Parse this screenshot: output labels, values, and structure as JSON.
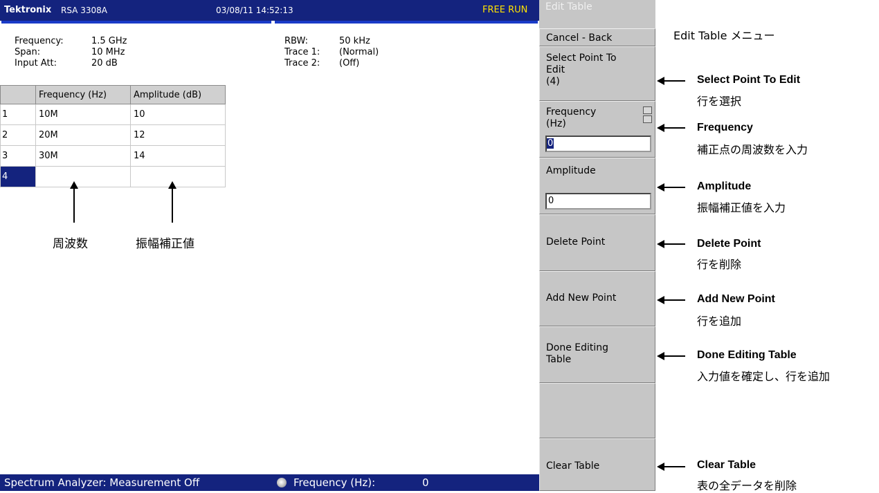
{
  "header": {
    "brand": "Tektronix",
    "model": "RSA 3308A",
    "datetime": "03/08/11 14:52:13",
    "run_state": "FREE RUN"
  },
  "settings_left": [
    {
      "label": "Frequency:",
      "value": "1.5 GHz"
    },
    {
      "label": "Span:",
      "value": "10 MHz"
    },
    {
      "label": "Input Att:",
      "value": "20 dB"
    }
  ],
  "settings_right": [
    {
      "label": "RBW:",
      "value": "50 kHz"
    },
    {
      "label": "Trace 1:",
      "value": "(Normal)"
    },
    {
      "label": "Trace 2:",
      "value": "(Off)"
    }
  ],
  "table": {
    "headers": [
      "",
      "Frequency (Hz)",
      "Amplitude (dB)"
    ],
    "rows": [
      {
        "index": "1",
        "frequency": "10M",
        "amplitude": "10"
      },
      {
        "index": "2",
        "frequency": "20M",
        "amplitude": "12"
      },
      {
        "index": "3",
        "frequency": "30M",
        "amplitude": "14"
      },
      {
        "index": "4",
        "frequency": "",
        "amplitude": ""
      }
    ]
  },
  "annotations": {
    "frequency_jp": "周波数",
    "amplitude_jp": "振幅補正値"
  },
  "status_bar": {
    "text": "Spectrum Analyzer: Measurement Off",
    "knob_label": "Frequency (Hz):",
    "knob_value": "0"
  },
  "menu": {
    "title": "Edit Table",
    "cancel_back": "Cancel - Back",
    "select_point_line1": "Select Point To",
    "select_point_line2": "Edit",
    "select_point_value": "(4)",
    "frequency_line1": "Frequency",
    "frequency_line2": "(Hz)",
    "frequency_value": "0",
    "amplitude_label": "Amplitude",
    "amplitude_value": "0",
    "delete_point": "Delete Point",
    "add_new_point": "Add New Point",
    "done_line1": "Done Editing",
    "done_line2": "Table",
    "clear_table": "Clear Table"
  },
  "callouts": {
    "menu_caption": "Edit Table メニュー",
    "items": [
      {
        "title": "Select Point To Edit",
        "desc": "行を選択"
      },
      {
        "title": "Frequency",
        "desc": "補正点の周波数を入力"
      },
      {
        "title": "Amplitude",
        "desc": "振幅補正値を入力"
      },
      {
        "title": "Delete Point",
        "desc": "行を削除"
      },
      {
        "title": "Add New Point",
        "desc": "行を追加"
      },
      {
        "title": "Done Editing Table",
        "desc": "入力値を確定し、行を追加"
      },
      {
        "title": "Clear Table",
        "desc": "表の全データを削除"
      }
    ]
  },
  "colors": {
    "title_bar": "#14237e",
    "free_run": "#ffe100",
    "menu_gray": "#c6c6c6"
  }
}
